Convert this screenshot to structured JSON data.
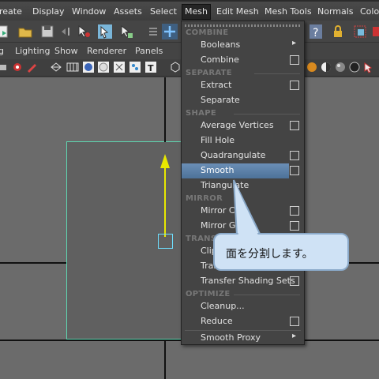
{
  "menubar": {
    "items": [
      "reate",
      "Display",
      "Window",
      "Assets",
      "Select",
      "Mesh",
      "Edit Mesh",
      "Mesh Tools",
      "Normals",
      "Colo"
    ],
    "active": "Mesh"
  },
  "panel_menu": [
    "g",
    "Lighting",
    "Show",
    "Renderer",
    "Panels"
  ],
  "mesh_menu": {
    "sections": {
      "combine": "COMBINE",
      "separate": "SEPARATE",
      "shape": "SHAPE",
      "mirror": "MIRROR",
      "transfer": "TRANSF",
      "optimize": "OPTIMIZE"
    },
    "items": {
      "booleans": "Booleans",
      "combine": "Combine",
      "extract": "Extract",
      "separate": "Separate",
      "average_vertices": "Average Vertices",
      "fill_hole": "Fill Hole",
      "quadrangulate": "Quadrangulate",
      "smooth": "Smooth",
      "triangulate": "Triangulate",
      "mirror_cut": "Mirror C",
      "mirror_geometry": "Mirror Geo",
      "clip": "Clip",
      "transfer": "Tran",
      "transfer_shading_sets": "Transfer Shading Sets",
      "cleanup": "Cleanup...",
      "reduce": "Reduce",
      "smooth_proxy": "Smooth Proxy"
    },
    "highlighted": "Smooth"
  },
  "callout": {
    "text": "面を分割します。"
  },
  "colors": {
    "menu_bg": "#444444",
    "highlight": "#5b80a8",
    "viewport_bg": "#6b6b6b",
    "wire": "#5fd7b2",
    "manipulator": "#e8e800",
    "callout_bg": "#cfe2f5"
  }
}
